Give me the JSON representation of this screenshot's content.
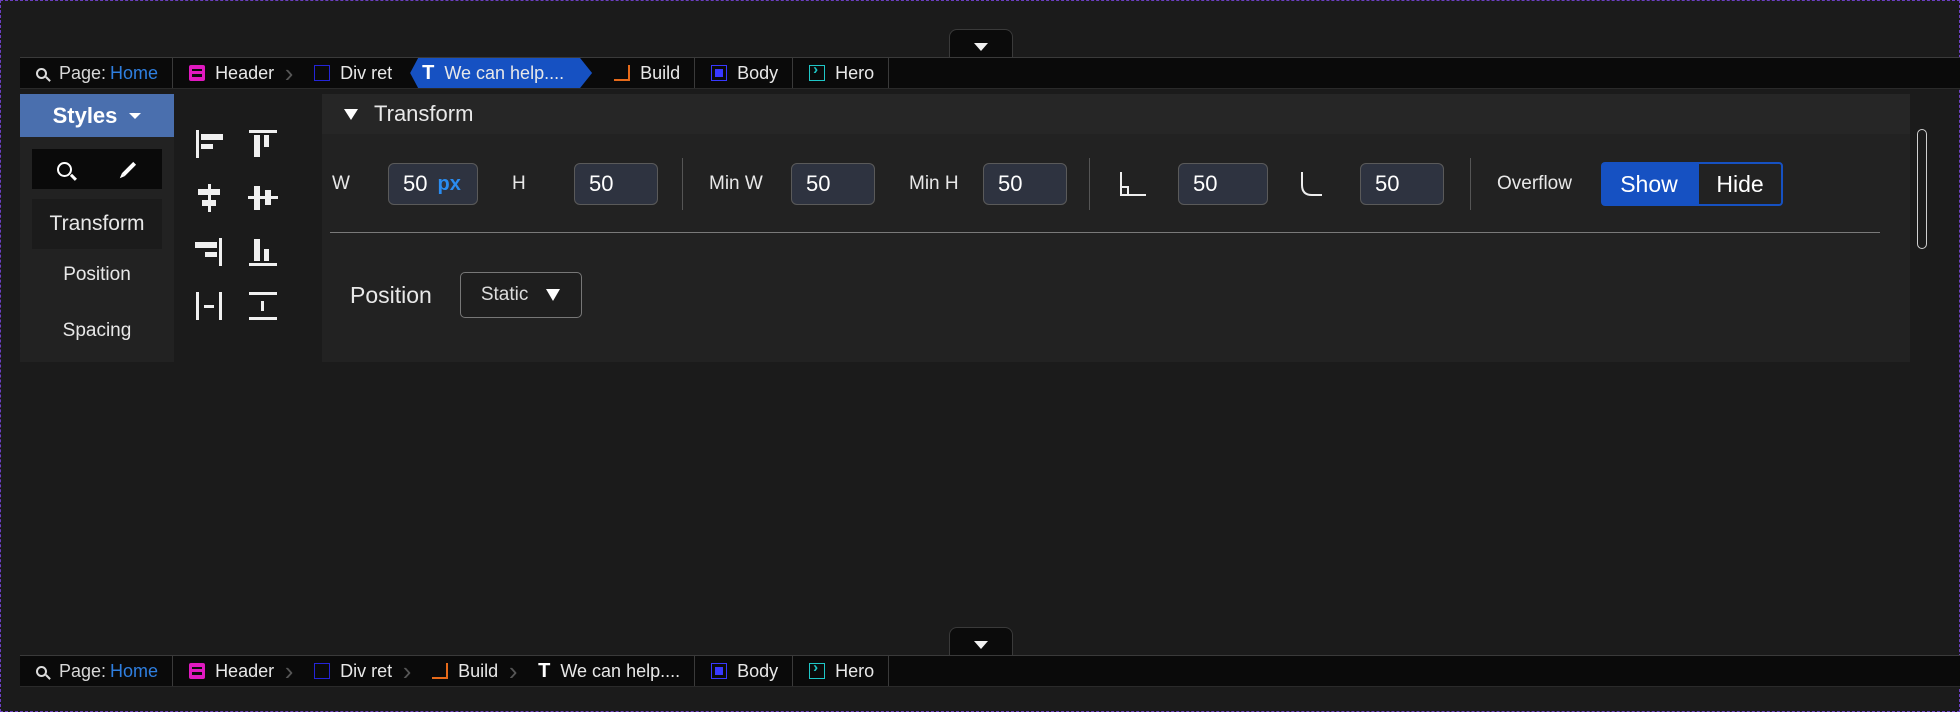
{
  "top_breadcrumb": {
    "page_label": "Page:",
    "page_name": "Home",
    "items": [
      {
        "label": "Header"
      },
      {
        "label": "Div ret"
      },
      {
        "label": "We can help...."
      },
      {
        "label": "Build"
      },
      {
        "label": "Body"
      },
      {
        "label": "Hero"
      }
    ]
  },
  "bottom_breadcrumb": {
    "page_label": "Page:",
    "page_name": "Home",
    "items": [
      {
        "label": "Header"
      },
      {
        "label": "Div ret"
      },
      {
        "label": "Build"
      },
      {
        "label": "We can help...."
      },
      {
        "label": "Body"
      },
      {
        "label": "Hero"
      }
    ]
  },
  "sidebar": {
    "styles_label": "Styles",
    "items": [
      {
        "label": "Transform",
        "active": true
      },
      {
        "label": "Position"
      },
      {
        "label": "Spacing"
      }
    ]
  },
  "transform": {
    "title": "Transform",
    "w_label": "W",
    "w_value": "50",
    "w_unit": "px",
    "h_label": "H",
    "h_value": "50",
    "minw_label": "Min W",
    "minw_value": "50",
    "minh_label": "Min H",
    "minh_value": "50",
    "corner1_value": "50",
    "corner2_value": "50",
    "overflow_label": "Overflow",
    "overflow_show": "Show",
    "overflow_hide": "Hide"
  },
  "position": {
    "label": "Position",
    "value": "Static"
  },
  "colors": {
    "accent": "#1651c2",
    "header_icon": "#e019c0",
    "build_icon": "#e66a1a",
    "hero_icon": "#1fc6c6",
    "frame_border": "#6c3fc2"
  }
}
